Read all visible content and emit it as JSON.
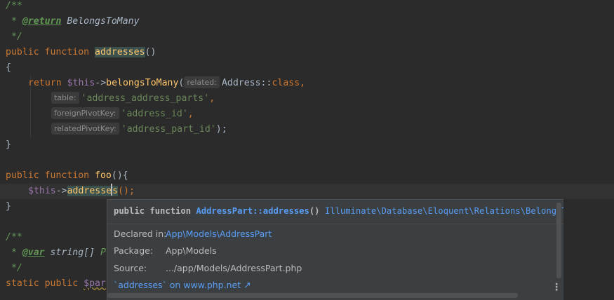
{
  "editor": {
    "doc1": {
      "open": "/**",
      "star": " * ",
      "tag": "@return",
      "type": " BelongsToMany",
      "close": " */"
    },
    "decl1": {
      "kw": "public function ",
      "name": "addresses",
      "rest": "()"
    },
    "brace_open": "{",
    "ret": {
      "kw": "return ",
      "this": "$this",
      "arrow": "->",
      "fn": "belongsToMany",
      "paren": "(",
      "hint_related": "related:",
      "cls": "Address::",
      "kwclass": "class",
      "comma": ","
    },
    "arg_table": {
      "hint": "table:",
      "value": "'address_address_parts'",
      "punct": ","
    },
    "arg_fpk": {
      "hint": "foreignPivotKey:",
      "value": "'address_id'",
      "punct": ","
    },
    "arg_rpk": {
      "hint": "relatedPivotKey:",
      "value": "'address_part_id'",
      "punct": ");"
    },
    "brace_close": "}",
    "decl2": {
      "kw": "public function ",
      "name": "foo",
      "rest": "(){"
    },
    "call": {
      "this": "$this",
      "arrow": "->",
      "name_a": "addresse",
      "name_b": "s",
      "rest": "();"
    },
    "brace_close2": "}",
    "doc2": {
      "open": "/**",
      "star": " * ",
      "tag": "@var",
      "type": " string[] ",
      "tail": "P",
      "close": " */"
    },
    "static_line": {
      "kw": "static public ",
      "var": "$par"
    }
  },
  "popup": {
    "sig_kw": "public function ",
    "sig_name": "AddressPart::addresses",
    "sig_paren": "() ",
    "sig_return": "Illuminate\\Database\\Eloquent\\Relations\\BelongsToMan",
    "declared_label": "Declared in:",
    "declared_value": "App\\Models\\AddressPart",
    "package_label": "Package:",
    "package_value": "App\\Models",
    "source_label": "Source:",
    "source_value": ".../app/Models/AddressPart.php",
    "footer_link": "`addresses` on www.php.net ↗",
    "more_icon": "⋮"
  }
}
